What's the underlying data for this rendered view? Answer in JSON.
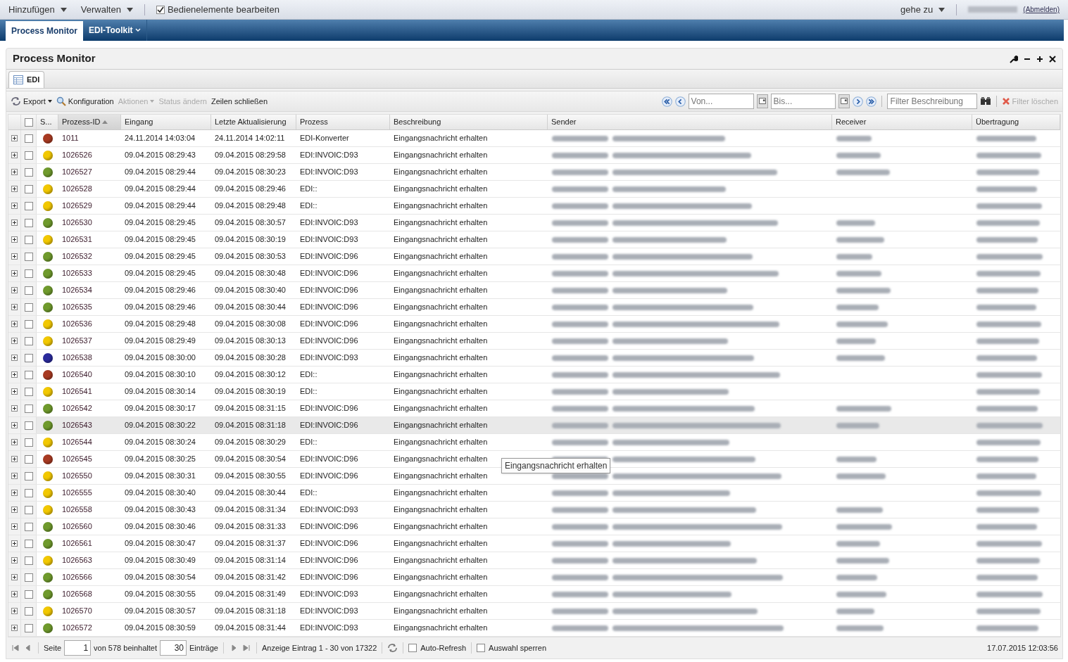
{
  "top_bar": {
    "menus": [
      "Hinzufügen",
      "Verwalten"
    ],
    "edit_controls": {
      "label": "Bedienelemente bearbeiten",
      "checked": true
    },
    "goto": "gehe zu",
    "logout": "(Abmelden)"
  },
  "nav_tabs": [
    {
      "label": "Process Monitor",
      "selected": true,
      "dropdown": false
    },
    {
      "label": "EDI-Toolkit",
      "selected": false,
      "dropdown": true
    }
  ],
  "panel": {
    "title": "Process Monitor",
    "tabs": [
      {
        "label": "EDI",
        "selected": true
      }
    ]
  },
  "toolbar": {
    "left": [
      {
        "label": "Export",
        "disabled": false,
        "dropdown": true,
        "kind": "refresh"
      },
      {
        "label": "Konfiguration",
        "disabled": false,
        "dropdown": false,
        "kind": "search"
      },
      {
        "label": "Aktionen",
        "disabled": true,
        "dropdown": true,
        "kind": "plain"
      },
      {
        "label": "Status ändern",
        "disabled": true,
        "dropdown": false,
        "kind": "plain"
      },
      {
        "label": "Zeilen schließen",
        "disabled": false,
        "dropdown": false,
        "kind": "plain"
      }
    ],
    "from_placeholder": "Von...",
    "to_placeholder": "Bis...",
    "filter_placeholder": "Filter Beschreibung",
    "clear_filter": {
      "label": "Filter löschen",
      "disabled": true
    }
  },
  "table": {
    "all_checked": false,
    "columns": [
      {
        "label": "S...",
        "sorted": false
      },
      {
        "label": "Prozess-ID",
        "sorted": true
      },
      {
        "label": "Eingang",
        "sorted": false
      },
      {
        "label": "Letzte Aktualisierung",
        "sorted": false
      },
      {
        "label": "Prozess",
        "sorted": false
      },
      {
        "label": "Beschreibung",
        "sorted": false
      },
      {
        "label": "Sender",
        "sorted": false
      },
      {
        "label": "Receiver",
        "sorted": false
      },
      {
        "label": "Übertragung",
        "sorted": false
      }
    ],
    "rows": [
      {
        "color": "#a83a22",
        "id": "1011",
        "received": "24.11.2014 14:03:04",
        "updated": "24.11.2014 14:02:11",
        "process": "EDI-Konverter",
        "description": "Eingangsnachricht erhalten",
        "has_receiver": true,
        "highlighted": false,
        "checked": false
      },
      {
        "color": "#f2c800",
        "id": "1026526",
        "received": "09.04.2015 08:29:43",
        "updated": "09.04.2015 08:29:58",
        "process": "EDI:INVOIC:D93",
        "description": "Eingangsnachricht erhalten",
        "has_receiver": true,
        "highlighted": false,
        "checked": false
      },
      {
        "color": "#6f9a2c",
        "id": "1026527",
        "received": "09.04.2015 08:29:44",
        "updated": "09.04.2015 08:30:23",
        "process": "EDI:INVOIC:D93",
        "description": "Eingangsnachricht erhalten",
        "has_receiver": true,
        "highlighted": false,
        "checked": false
      },
      {
        "color": "#f2c800",
        "id": "1026528",
        "received": "09.04.2015 08:29:44",
        "updated": "09.04.2015 08:29:46",
        "process": "EDI::",
        "description": "Eingangsnachricht erhalten",
        "has_receiver": false,
        "highlighted": false,
        "checked": false
      },
      {
        "color": "#f2c800",
        "id": "1026529",
        "received": "09.04.2015 08:29:44",
        "updated": "09.04.2015 08:29:48",
        "process": "EDI::",
        "description": "Eingangsnachricht erhalten",
        "has_receiver": false,
        "highlighted": false,
        "checked": false
      },
      {
        "color": "#6f9a2c",
        "id": "1026530",
        "received": "09.04.2015 08:29:45",
        "updated": "09.04.2015 08:30:57",
        "process": "EDI:INVOIC:D93",
        "description": "Eingangsnachricht erhalten",
        "has_receiver": true,
        "highlighted": false,
        "checked": false
      },
      {
        "color": "#f2c800",
        "id": "1026531",
        "received": "09.04.2015 08:29:45",
        "updated": "09.04.2015 08:30:19",
        "process": "EDI:INVOIC:D93",
        "description": "Eingangsnachricht erhalten",
        "has_receiver": true,
        "highlighted": false,
        "checked": false
      },
      {
        "color": "#6f9a2c",
        "id": "1026532",
        "received": "09.04.2015 08:29:45",
        "updated": "09.04.2015 08:30:53",
        "process": "EDI:INVOIC:D96",
        "description": "Eingangsnachricht erhalten",
        "has_receiver": true,
        "highlighted": false,
        "checked": false
      },
      {
        "color": "#6f9a2c",
        "id": "1026533",
        "received": "09.04.2015 08:29:45",
        "updated": "09.04.2015 08:30:48",
        "process": "EDI:INVOIC:D96",
        "description": "Eingangsnachricht erhalten",
        "has_receiver": true,
        "highlighted": false,
        "checked": false
      },
      {
        "color": "#6f9a2c",
        "id": "1026534",
        "received": "09.04.2015 08:29:46",
        "updated": "09.04.2015 08:30:40",
        "process": "EDI:INVOIC:D96",
        "description": "Eingangsnachricht erhalten",
        "has_receiver": true,
        "highlighted": false,
        "checked": false
      },
      {
        "color": "#6f9a2c",
        "id": "1026535",
        "received": "09.04.2015 08:29:46",
        "updated": "09.04.2015 08:30:44",
        "process": "EDI:INVOIC:D96",
        "description": "Eingangsnachricht erhalten",
        "has_receiver": true,
        "highlighted": false,
        "checked": false
      },
      {
        "color": "#f2c800",
        "id": "1026536",
        "received": "09.04.2015 08:29:48",
        "updated": "09.04.2015 08:30:08",
        "process": "EDI:INVOIC:D96",
        "description": "Eingangsnachricht erhalten",
        "has_receiver": true,
        "highlighted": false,
        "checked": false
      },
      {
        "color": "#f2c800",
        "id": "1026537",
        "received": "09.04.2015 08:29:49",
        "updated": "09.04.2015 08:30:13",
        "process": "EDI:INVOIC:D96",
        "description": "Eingangsnachricht erhalten",
        "has_receiver": true,
        "highlighted": false,
        "checked": false
      },
      {
        "color": "#2a2a9c",
        "id": "1026538",
        "received": "09.04.2015 08:30:00",
        "updated": "09.04.2015 08:30:28",
        "process": "EDI:INVOIC:D93",
        "description": "Eingangsnachricht erhalten",
        "has_receiver": true,
        "highlighted": false,
        "checked": false
      },
      {
        "color": "#a83a22",
        "id": "1026540",
        "received": "09.04.2015 08:30:10",
        "updated": "09.04.2015 08:30:12",
        "process": "EDI::",
        "description": "Eingangsnachricht erhalten",
        "has_receiver": false,
        "highlighted": false,
        "checked": false
      },
      {
        "color": "#f2c800",
        "id": "1026541",
        "received": "09.04.2015 08:30:14",
        "updated": "09.04.2015 08:30:19",
        "process": "EDI::",
        "description": "Eingangsnachricht erhalten",
        "has_receiver": false,
        "highlighted": false,
        "checked": false
      },
      {
        "color": "#6f9a2c",
        "id": "1026542",
        "received": "09.04.2015 08:30:17",
        "updated": "09.04.2015 08:31:15",
        "process": "EDI:INVOIC:D96",
        "description": "Eingangsnachricht erhalten",
        "has_receiver": true,
        "highlighted": false,
        "checked": false
      },
      {
        "color": "#6f9a2c",
        "id": "1026543",
        "received": "09.04.2015 08:30:22",
        "updated": "09.04.2015 08:31:18",
        "process": "EDI:INVOIC:D96",
        "description": "Eingangsnachricht erhalten",
        "has_receiver": true,
        "highlighted": true,
        "checked": false
      },
      {
        "color": "#f2c800",
        "id": "1026544",
        "received": "09.04.2015 08:30:24",
        "updated": "09.04.2015 08:30:29",
        "process": "EDI::",
        "description": "Eingangsnachricht erhalten",
        "has_receiver": false,
        "highlighted": false,
        "checked": false
      },
      {
        "color": "#a83a22",
        "id": "1026545",
        "received": "09.04.2015 08:30:25",
        "updated": "09.04.2015 08:30:54",
        "process": "EDI:INVOIC:D96",
        "description": "Eingangsnachricht erhalten",
        "has_receiver": true,
        "highlighted": false,
        "checked": false
      },
      {
        "color": "#f2c800",
        "id": "1026550",
        "received": "09.04.2015 08:30:31",
        "updated": "09.04.2015 08:30:55",
        "process": "EDI:INVOIC:D96",
        "description": "Eingangsnachricht erhalten",
        "has_receiver": true,
        "highlighted": false,
        "checked": false
      },
      {
        "color": "#f2c800",
        "id": "1026555",
        "received": "09.04.2015 08:30:40",
        "updated": "09.04.2015 08:30:44",
        "process": "EDI::",
        "description": "Eingangsnachricht erhalten",
        "has_receiver": false,
        "highlighted": false,
        "checked": false
      },
      {
        "color": "#f2c800",
        "id": "1026558",
        "received": "09.04.2015 08:30:43",
        "updated": "09.04.2015 08:31:34",
        "process": "EDI:INVOIC:D93",
        "description": "Eingangsnachricht erhalten",
        "has_receiver": true,
        "highlighted": false,
        "checked": false
      },
      {
        "color": "#6f9a2c",
        "id": "1026560",
        "received": "09.04.2015 08:30:46",
        "updated": "09.04.2015 08:31:33",
        "process": "EDI:INVOIC:D96",
        "description": "Eingangsnachricht erhalten",
        "has_receiver": true,
        "highlighted": false,
        "checked": false
      },
      {
        "color": "#6f9a2c",
        "id": "1026561",
        "received": "09.04.2015 08:30:47",
        "updated": "09.04.2015 08:31:37",
        "process": "EDI:INVOIC:D96",
        "description": "Eingangsnachricht erhalten",
        "has_receiver": true,
        "highlighted": false,
        "checked": false
      },
      {
        "color": "#f2c800",
        "id": "1026563",
        "received": "09.04.2015 08:30:49",
        "updated": "09.04.2015 08:31:14",
        "process": "EDI:INVOIC:D96",
        "description": "Eingangsnachricht erhalten",
        "has_receiver": true,
        "highlighted": false,
        "checked": false
      },
      {
        "color": "#6f9a2c",
        "id": "1026566",
        "received": "09.04.2015 08:30:54",
        "updated": "09.04.2015 08:31:42",
        "process": "EDI:INVOIC:D96",
        "description": "Eingangsnachricht erhalten",
        "has_receiver": true,
        "highlighted": false,
        "checked": false
      },
      {
        "color": "#6f9a2c",
        "id": "1026568",
        "received": "09.04.2015 08:30:55",
        "updated": "09.04.2015 08:31:49",
        "process": "EDI:INVOIC:D93",
        "description": "Eingangsnachricht erhalten",
        "has_receiver": true,
        "highlighted": false,
        "checked": false
      },
      {
        "color": "#f2c800",
        "id": "1026570",
        "received": "09.04.2015 08:30:57",
        "updated": "09.04.2015 08:31:18",
        "process": "EDI:INVOIC:D93",
        "description": "Eingangsnachricht erhalten",
        "has_receiver": true,
        "highlighted": false,
        "checked": false
      },
      {
        "color": "#6f9a2c",
        "id": "1026572",
        "received": "09.04.2015 08:30:59",
        "updated": "09.04.2015 08:31:44",
        "process": "EDI:INVOIC:D93",
        "description": "Eingangsnachricht erhalten",
        "has_receiver": true,
        "highlighted": false,
        "checked": false
      }
    ],
    "tooltip": "Eingangsnachricht erhalten"
  },
  "pager": {
    "page_label": "Seite",
    "page": "1",
    "of_label": "von 578 beinhaltet",
    "page_size": "30",
    "entries_label": "Einträge",
    "summary": "Anzeige Eintrag 1 - 30 von 17322",
    "auto_refresh": {
      "label": "Auto-Refresh",
      "checked": false
    },
    "lock_selection": {
      "label": "Auswahl sperren",
      "checked": false
    },
    "timestamp": "17.07.2015 12:03:56"
  }
}
